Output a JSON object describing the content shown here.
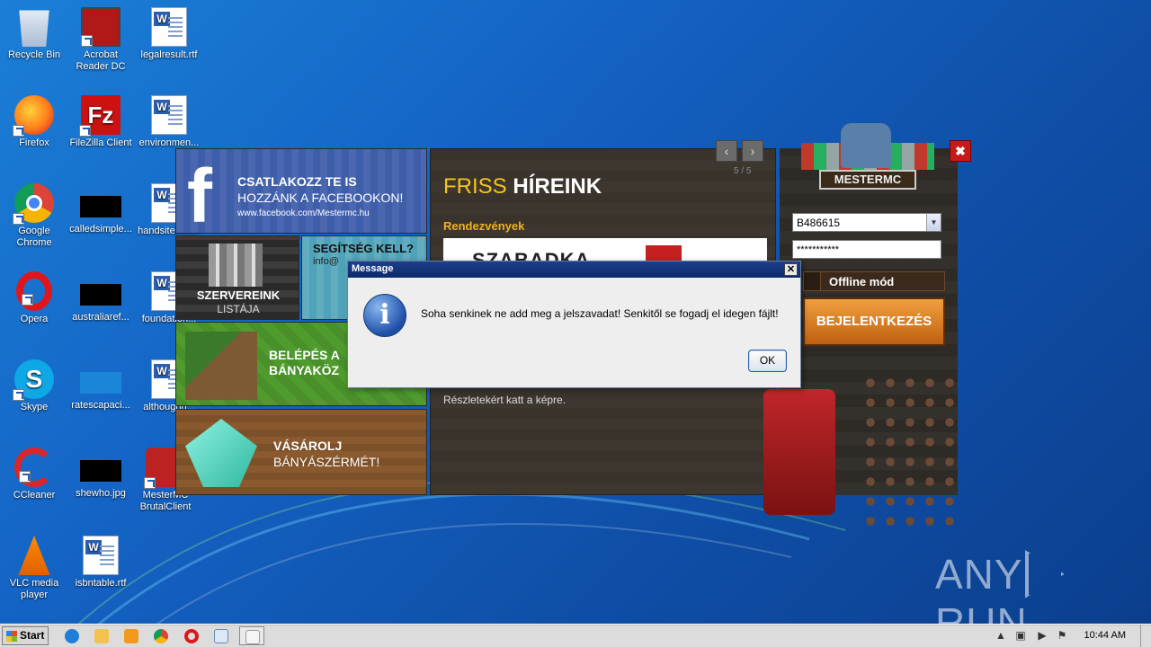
{
  "desktop": {
    "icons": [
      {
        "label": "Recycle Bin"
      },
      {
        "label": "Acrobat Reader DC"
      },
      {
        "label": "legalresult.rtf"
      },
      {
        "label": "Firefox"
      },
      {
        "label": "FileZilla Client"
      },
      {
        "label": "environmen..."
      },
      {
        "label": "Google Chrome"
      },
      {
        "label": "calledsimple..."
      },
      {
        "label": "handsitem.rt..."
      },
      {
        "label": "Opera"
      },
      {
        "label": "australiaref..."
      },
      {
        "label": "foundation..."
      },
      {
        "label": "Skype"
      },
      {
        "label": "ratescapaci..."
      },
      {
        "label": "althoughn..."
      },
      {
        "label": "CCleaner"
      },
      {
        "label": "shewho.jpg"
      },
      {
        "label": "MesterMC BrutalClient"
      },
      {
        "label": "VLC media player"
      },
      {
        "label": "isbntable.rtf"
      }
    ]
  },
  "launcher": {
    "facebook": {
      "line1": "CSATLAKOZZ TE IS",
      "line2": "HOZZÁNK A FACEBOOKON!",
      "url": "www.facebook.com/Mestermc.hu"
    },
    "servers": {
      "line1": "SZERVEREINK",
      "line2": "LISTÁJA"
    },
    "help": {
      "line1": "SEGÍTSÉG KELL?",
      "line2": "info@"
    },
    "join": {
      "line1": "BELÉPÉS A",
      "line2": "BÁNYAKÖZ"
    },
    "shop": {
      "line1": "VÁSÁROLJ",
      "line2": "BÁNYÁSZÉRMÉT!"
    },
    "news": {
      "title_a": "FRISS",
      "title_b": "HÍREINK",
      "counter": "5 / 5",
      "category": "Rendezvények",
      "banner_text": "SZABADKA",
      "body_line": "Részletekért katt a képre.",
      "prev_icon": "chevron-left-icon",
      "next_icon": "chevron-right-icon"
    },
    "logo_text": "MESTERMC",
    "login": {
      "username": "B486615",
      "password_mask": "***********",
      "offline_label": "Offline mód",
      "login_button": "BEJELENTKEZÉS"
    },
    "close_icon": "close-icon"
  },
  "dialog": {
    "title": "Message",
    "message": "Soha senkinek ne add meg a jelszavadat! Senkitől se fogadj el idegen fájlt!",
    "ok_label": "OK",
    "icon": "info-icon"
  },
  "watermark": {
    "left": "ANY",
    "right": "RUN"
  },
  "taskbar": {
    "start_label": "Start",
    "clock": "10:44 AM"
  }
}
